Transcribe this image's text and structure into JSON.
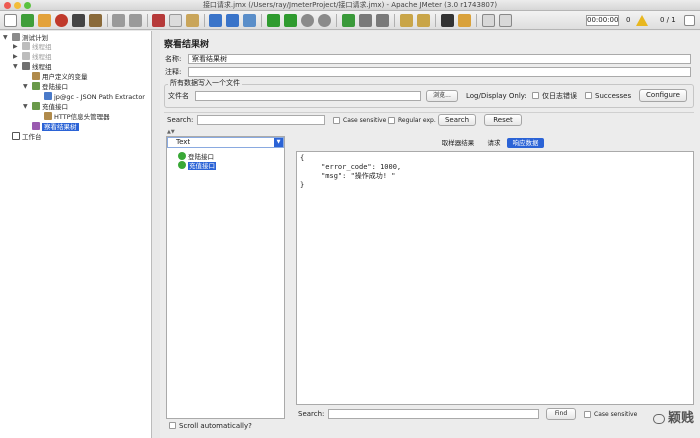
{
  "window": {
    "title": "接口请求.jmx (/Users/ray/JmeterProject/接口请求.jmx) - Apache JMeter (3.0 r1743807)"
  },
  "toolbar": {
    "timer": "00:00:00",
    "warning_count": "0",
    "threads": "0 / 1",
    "icons": [
      "new-icon",
      "templates-icon",
      "open-icon",
      "close-icon",
      "save-icon",
      "save-as-icon",
      "cut-icon",
      "copy-icon",
      "paste-icon",
      "expand-icon",
      "collapse-icon",
      "toggle-icon",
      "start-icon",
      "start-no-pause-icon",
      "stop-icon",
      "shutdown-icon",
      "remote-start-icon",
      "remote-stop-icon",
      "remote-exit-icon",
      "clear-icon",
      "clear-all-icon",
      "search-icon",
      "reset-search-icon",
      "function-helper-icon",
      "help-icon"
    ]
  },
  "tree": {
    "items": [
      {
        "label": "测试计划"
      },
      {
        "label": "线程组"
      },
      {
        "label": "线程组"
      },
      {
        "label": "线程组"
      },
      {
        "label": "用户定义的变量"
      },
      {
        "label": "登陆接口"
      },
      {
        "label": "jp@gc - JSON Path Extractor"
      },
      {
        "label": "充值接口"
      },
      {
        "label": "HTTP信息头管理器"
      },
      {
        "label": "察看结果树"
      },
      {
        "label": "工作台"
      }
    ]
  },
  "panel": {
    "title": "察看结果树",
    "name_label": "名称:",
    "name_value": "察看结果树",
    "comment_label": "注释:",
    "comment_value": "",
    "write_group_label": "所有数据写入一个文件",
    "filename_label": "文件名",
    "filename_value": "",
    "browse_button": "浏览...",
    "log_display_label": "Log/Display Only:",
    "errors_only_label": "仅日志错误",
    "successes_label": "Successes",
    "configure_button": "Configure"
  },
  "search_bar": {
    "label": "Search:",
    "value": "",
    "case_sensitive": "Case sensitive",
    "regular_exp": "Regular exp.",
    "search_button": "Search",
    "reset_button": "Reset"
  },
  "results": {
    "renderer": "Text",
    "samples": [
      {
        "label": "登陆接口",
        "selected": false
      },
      {
        "label": "充值接口",
        "selected": true
      }
    ],
    "scroll_automatically": "Scroll automatically?"
  },
  "detail": {
    "tabs": [
      {
        "label": "取样器结果",
        "active": false
      },
      {
        "label": "请求",
        "active": false
      },
      {
        "label": "响应数据",
        "active": true
      }
    ],
    "response_lines": [
      "{",
      "     \"error_code\": 1000,",
      "     \"msg\": \"操作成功! \"",
      "}"
    ],
    "search_label": "Search:",
    "search_value": "",
    "find_button": "Find",
    "case_sensitive": "Case sensitive"
  },
  "watermark": "颖贱",
  "colors": {
    "accent": "#2b63d6",
    "success": "#39a836"
  }
}
